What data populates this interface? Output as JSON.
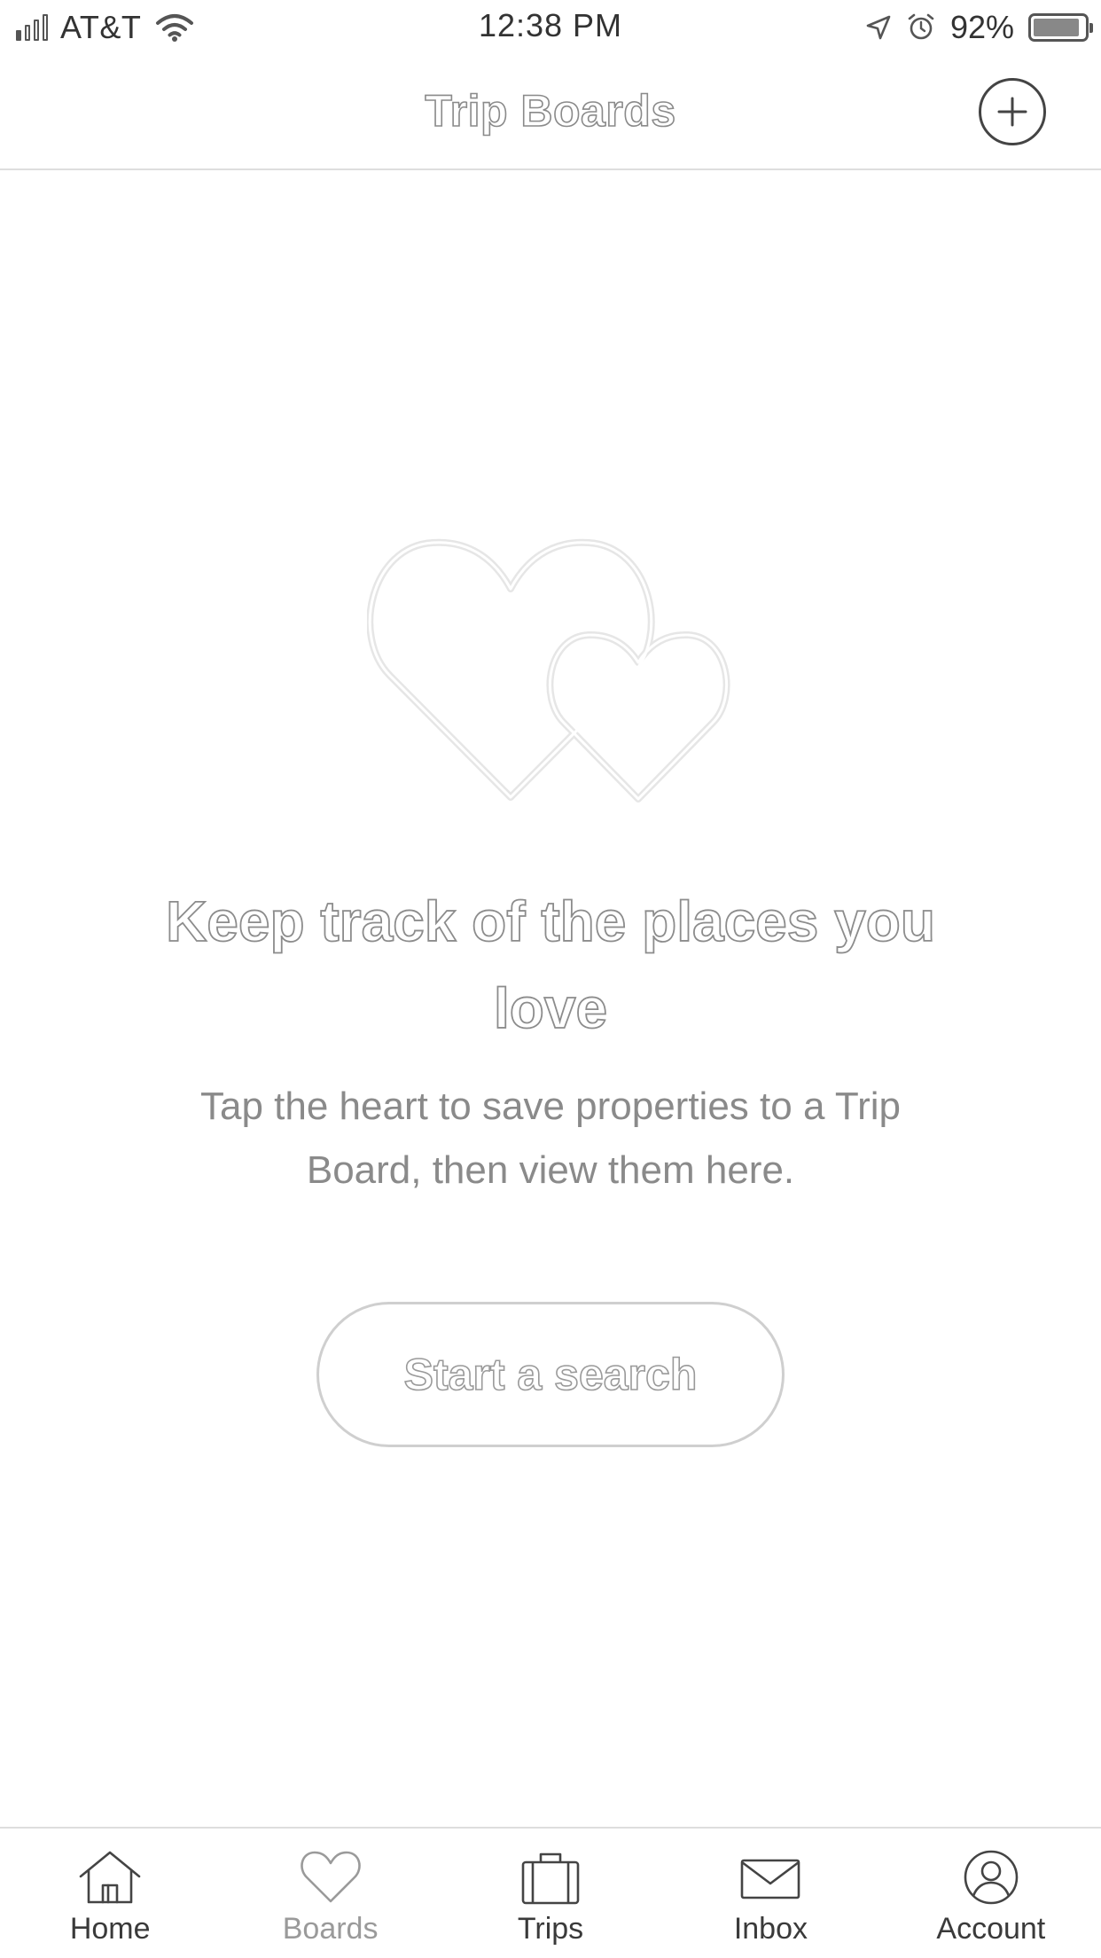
{
  "status_bar": {
    "carrier": "AT&T",
    "time": "12:38 PM",
    "battery_percent": "92%",
    "battery_level": 0.92,
    "signal_bars_filled": 1,
    "signal_bars_total": 4,
    "icons": [
      "signal-icon",
      "wifi-icon",
      "location-arrow-icon",
      "alarm-icon",
      "battery-icon"
    ]
  },
  "header": {
    "title": "Trip Boards",
    "add_icon": "plus-circle-icon"
  },
  "empty_state": {
    "illustration": "two-hearts-icon",
    "headline": "Keep track of the places you love",
    "description": "Tap the heart to save properties to a Trip Board, then view them here.",
    "button_label": "Start a search"
  },
  "tab_bar": {
    "active": "Boards",
    "tabs": [
      {
        "label": "Home",
        "icon": "home-icon"
      },
      {
        "label": "Boards",
        "icon": "heart-icon"
      },
      {
        "label": "Trips",
        "icon": "suitcase-icon"
      },
      {
        "label": "Inbox",
        "icon": "envelope-icon"
      },
      {
        "label": "Account",
        "icon": "user-circle-icon"
      }
    ]
  },
  "colors": {
    "background": "#ffffff",
    "divider": "#dedede",
    "text_dark": "#3a3a3a",
    "text_muted": "#8a8a8a",
    "outline": "#cfcfcf"
  }
}
